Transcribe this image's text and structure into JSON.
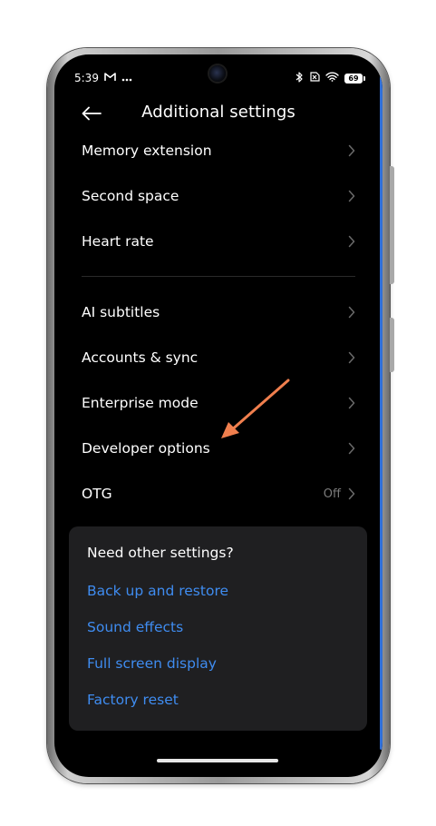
{
  "status_bar": {
    "time": "5:39",
    "left_icons": [
      "gmail-icon",
      "more-notifications-icon"
    ],
    "right_icons": [
      "bluetooth-icon",
      "no-sim-icon",
      "wifi-icon",
      "battery-icon"
    ],
    "battery_level": "69"
  },
  "header": {
    "title": "Additional settings",
    "back_icon": "back-arrow-icon"
  },
  "settings": {
    "group1": [
      {
        "label": "Memory extension"
      },
      {
        "label": "Second space"
      },
      {
        "label": "Heart rate"
      }
    ],
    "group2": [
      {
        "label": "AI subtitles"
      },
      {
        "label": "Accounts & sync"
      },
      {
        "label": "Enterprise mode"
      },
      {
        "label": "Developer options"
      },
      {
        "label": "OTG",
        "value": "Off"
      }
    ]
  },
  "annotation": {
    "color": "#f07f4e"
  },
  "suggestions": {
    "title": "Need other settings?",
    "links": [
      {
        "label": "Back up and restore"
      },
      {
        "label": "Sound effects"
      },
      {
        "label": "Full screen display"
      },
      {
        "label": "Factory reset"
      }
    ]
  },
  "colors": {
    "background": "#000000",
    "text": "#ffffff",
    "link": "#3f8cf0",
    "card": "#1f1f21",
    "secondary_text": "#7c7c7c"
  }
}
